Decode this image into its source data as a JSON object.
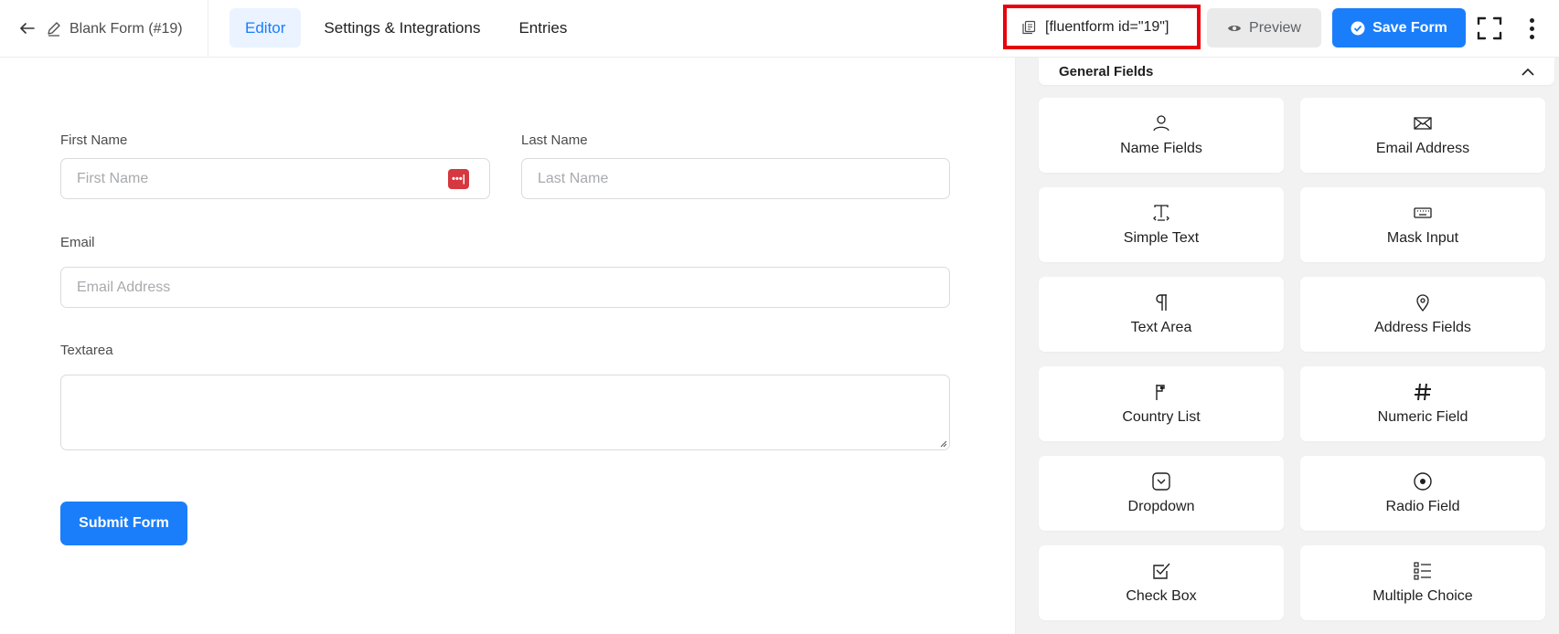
{
  "header": {
    "form_title": "Blank Form (#19)",
    "tabs": [
      {
        "label": "Editor",
        "active": true
      },
      {
        "label": "Settings & Integrations",
        "active": false
      },
      {
        "label": "Entries",
        "active": false
      }
    ],
    "shortcode": "[fluentform id=\"19\"]",
    "preview_label": "Preview",
    "save_label": "Save Form"
  },
  "form": {
    "first_name": {
      "label": "First Name",
      "placeholder": "First Name"
    },
    "last_name": {
      "label": "Last Name",
      "placeholder": "Last Name"
    },
    "email": {
      "label": "Email",
      "placeholder": "Email Address"
    },
    "textarea": {
      "label": "Textarea"
    },
    "submit_label": "Submit Form"
  },
  "sidebar": {
    "section_title": "General Fields",
    "fields": [
      {
        "label": "Name Fields",
        "icon": "person-icon"
      },
      {
        "label": "Email Address",
        "icon": "envelope-icon"
      },
      {
        "label": "Simple Text",
        "icon": "text-cursor-icon"
      },
      {
        "label": "Mask Input",
        "icon": "keyboard-icon"
      },
      {
        "label": "Text Area",
        "icon": "paragraph-icon"
      },
      {
        "label": "Address Fields",
        "icon": "map-pin-icon"
      },
      {
        "label": "Country List",
        "icon": "flag-icon"
      },
      {
        "label": "Numeric Field",
        "icon": "hash-icon"
      },
      {
        "label": "Dropdown",
        "icon": "dropdown-icon"
      },
      {
        "label": "Radio Field",
        "icon": "radio-icon"
      },
      {
        "label": "Check Box",
        "icon": "checkbox-icon"
      },
      {
        "label": "Multiple Choice",
        "icon": "list-icon"
      }
    ]
  },
  "colors": {
    "primary": "#1a7efb",
    "highlight_border": "#e8000b",
    "password_icon": "#d6383f",
    "sidebar_bg": "#f2f2f2"
  }
}
